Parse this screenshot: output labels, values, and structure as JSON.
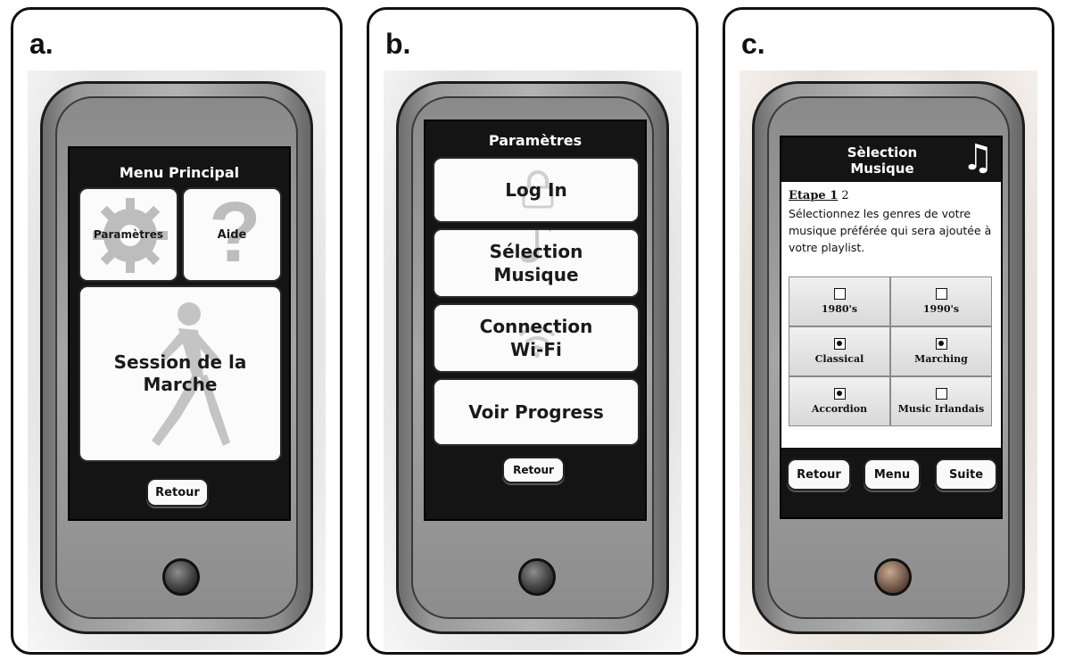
{
  "panels": [
    {
      "label": "a.",
      "screen_title": "Menu Principal",
      "tiles": {
        "settings": "Paramètres",
        "help": "Aide",
        "session": "Session de la Marche"
      },
      "back_button": "Retour"
    },
    {
      "label": "b.",
      "screen_title": "Paramètres",
      "menu": [
        "Log In",
        "Sélection Musique",
        "Connection Wi-Fi",
        "Voir Progress"
      ],
      "back_button": "Retour"
    },
    {
      "label": "c.",
      "screen_title": "Sèlection Musique",
      "step_label": "Etape 1",
      "step_next": "2",
      "instructions": "Sélectionnez les genres de votre musique préférée qui sera ajoutée à votre playlist.",
      "genres": [
        {
          "name": "1980's",
          "checked": false
        },
        {
          "name": "1990's",
          "checked": false
        },
        {
          "name": "Classical",
          "checked": true
        },
        {
          "name": "Marching",
          "checked": true
        },
        {
          "name": "Accordion",
          "checked": true
        },
        {
          "name": "Music Irlandais",
          "checked": false
        }
      ],
      "buttons": {
        "back": "Retour",
        "menu": "Menu",
        "next": "Suite"
      }
    }
  ],
  "icons": [
    "gear-icon",
    "question-mark-icon",
    "runner-icon",
    "lock-icon",
    "music-note-icon",
    "wifi-icon",
    "checkbox-icon"
  ],
  "colors": {
    "screen": "#141414",
    "tile": "#fbfbfb",
    "phone_body": "#9a9a9a"
  }
}
